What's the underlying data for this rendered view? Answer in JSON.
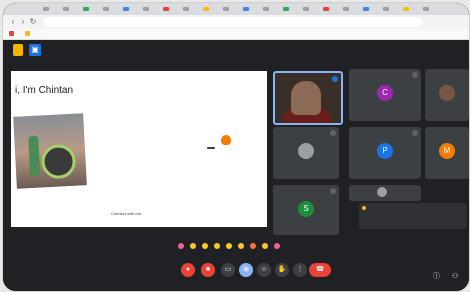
{
  "browser": {
    "url": "",
    "bookmarks": []
  },
  "meet": {
    "presenter_label": "",
    "meeting_info": ""
  },
  "slide": {
    "title": "i, I'm Chintan",
    "lines": [],
    "tooltip": "",
    "connect_heading": "Connect with me:"
  },
  "participants": [
    {
      "name": "",
      "avatar": "",
      "color": "#3a2e28",
      "camera": true
    },
    {
      "name": "",
      "avatar": "C",
      "color": "#9c27b0"
    },
    {
      "name": "",
      "avatar": "",
      "color": "#5f6368"
    },
    {
      "name": "",
      "avatar": "",
      "color": "#5f6368"
    },
    {
      "name": "",
      "avatar": "P",
      "color": "#1a73e8"
    },
    {
      "name": "",
      "avatar": "M",
      "color": "#f57c00"
    },
    {
      "name": "",
      "avatar": "S",
      "color": "#1e8e3e"
    },
    {
      "name": "",
      "avatar": "",
      "color": "#3c4043"
    },
    {
      "name": "",
      "avatar": "",
      "color": "#3c4043"
    }
  ],
  "chat_popup": {
    "lines": []
  },
  "colors": {
    "accent": "#1a73e8",
    "end_call": "#ea4335",
    "background": "#202124"
  }
}
